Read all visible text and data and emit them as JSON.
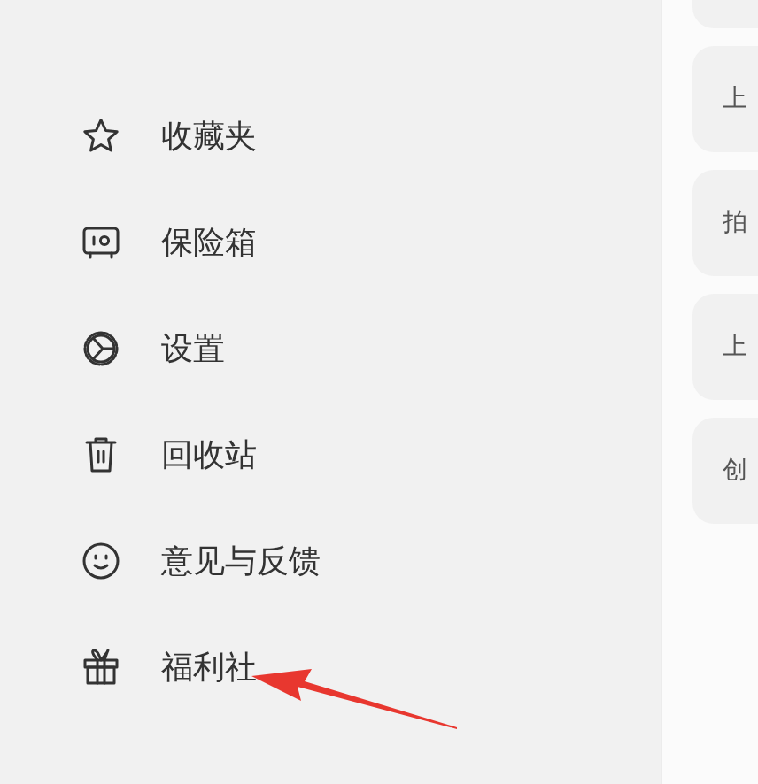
{
  "menu": [
    {
      "kind": "star",
      "label": "收藏夹"
    },
    {
      "kind": "safe",
      "label": "保险箱"
    },
    {
      "kind": "settings",
      "label": "设置"
    },
    {
      "kind": "trash",
      "label": "回收站"
    },
    {
      "kind": "smile",
      "label": "意见与反馈"
    },
    {
      "kind": "gift",
      "label": "福利社"
    }
  ],
  "cards": [
    {
      "text": "上"
    },
    {
      "text": "拍"
    },
    {
      "text": "上"
    },
    {
      "text": "创"
    }
  ]
}
